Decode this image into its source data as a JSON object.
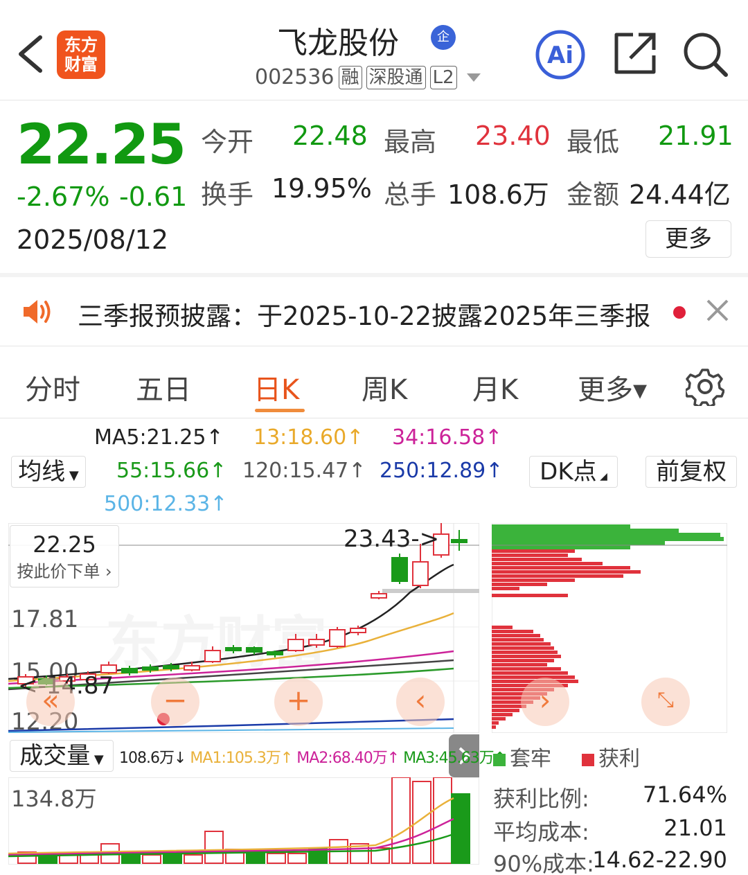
{
  "header": {
    "logo_line1": "东方",
    "logo_line2": "财富",
    "stock_name": "飞龙股份",
    "qi_badge": "企",
    "code": "002536",
    "tags": [
      "融",
      "深股通",
      "L2"
    ],
    "ai_label": "Ai"
  },
  "quote": {
    "price": "22.25",
    "change_pct": "-2.67%",
    "change": "-0.61",
    "date": "2025/08/12",
    "open_label": "今开",
    "open": "22.48",
    "high_label": "最高",
    "high": "23.40",
    "low_label": "最低",
    "low": "21.91",
    "turnover_label": "换手",
    "turnover": "19.95%",
    "volume_label": "总手",
    "volume": "108.6万",
    "amount_label": "金额",
    "amount": "24.44亿",
    "more_label": "更多",
    "colors": {
      "down": "#119911",
      "up": "#e0323c"
    }
  },
  "notice": {
    "text": "三季报预披露：于2025-10-22披露2025年三季报"
  },
  "tabs": [
    {
      "label": "分时",
      "active": false
    },
    {
      "label": "五日",
      "active": false
    },
    {
      "label": "日K",
      "active": true
    },
    {
      "label": "周K",
      "active": false
    },
    {
      "label": "月K",
      "active": false
    },
    {
      "label": "更多▾",
      "active": false
    }
  ],
  "indicators": {
    "ma_selector": "均线",
    "ma5": "MA5:21.25↑",
    "ma13": "13:18.60↑",
    "ma34": "34:16.58↑",
    "ma55": "55:15.66↑",
    "ma120": "120:15.47↑",
    "ma250": "250:12.89↑",
    "ma500": "500:12.33↑",
    "dk_button": "DK点",
    "fq_button": "前复权"
  },
  "kchart": {
    "price_tag": "22.25",
    "price_tag_sub": "按此价下单",
    "high_marker": "23.43->",
    "low_marker": "<-14.87",
    "axis_labels": [
      "17.81",
      "15.00",
      "12.20"
    ],
    "watermark": "东方财富"
  },
  "volume": {
    "selector": "成交量",
    "vol": "108.6万↓",
    "ma1": "MA1:105.3万↑",
    "ma2": "MA2:68.40万↑",
    "ma3": "MA3:45.63万↑",
    "axis_max": "134.8万"
  },
  "chip": {
    "legend_trapped": "套牢",
    "legend_profit": "获利",
    "profit_ratio_label": "获利比例:",
    "profit_ratio": "71.64%",
    "avg_cost_label": "平均成本:",
    "avg_cost": "21.01",
    "cost90_label": "90%成本:",
    "cost90": "14.62-22.90"
  }
}
